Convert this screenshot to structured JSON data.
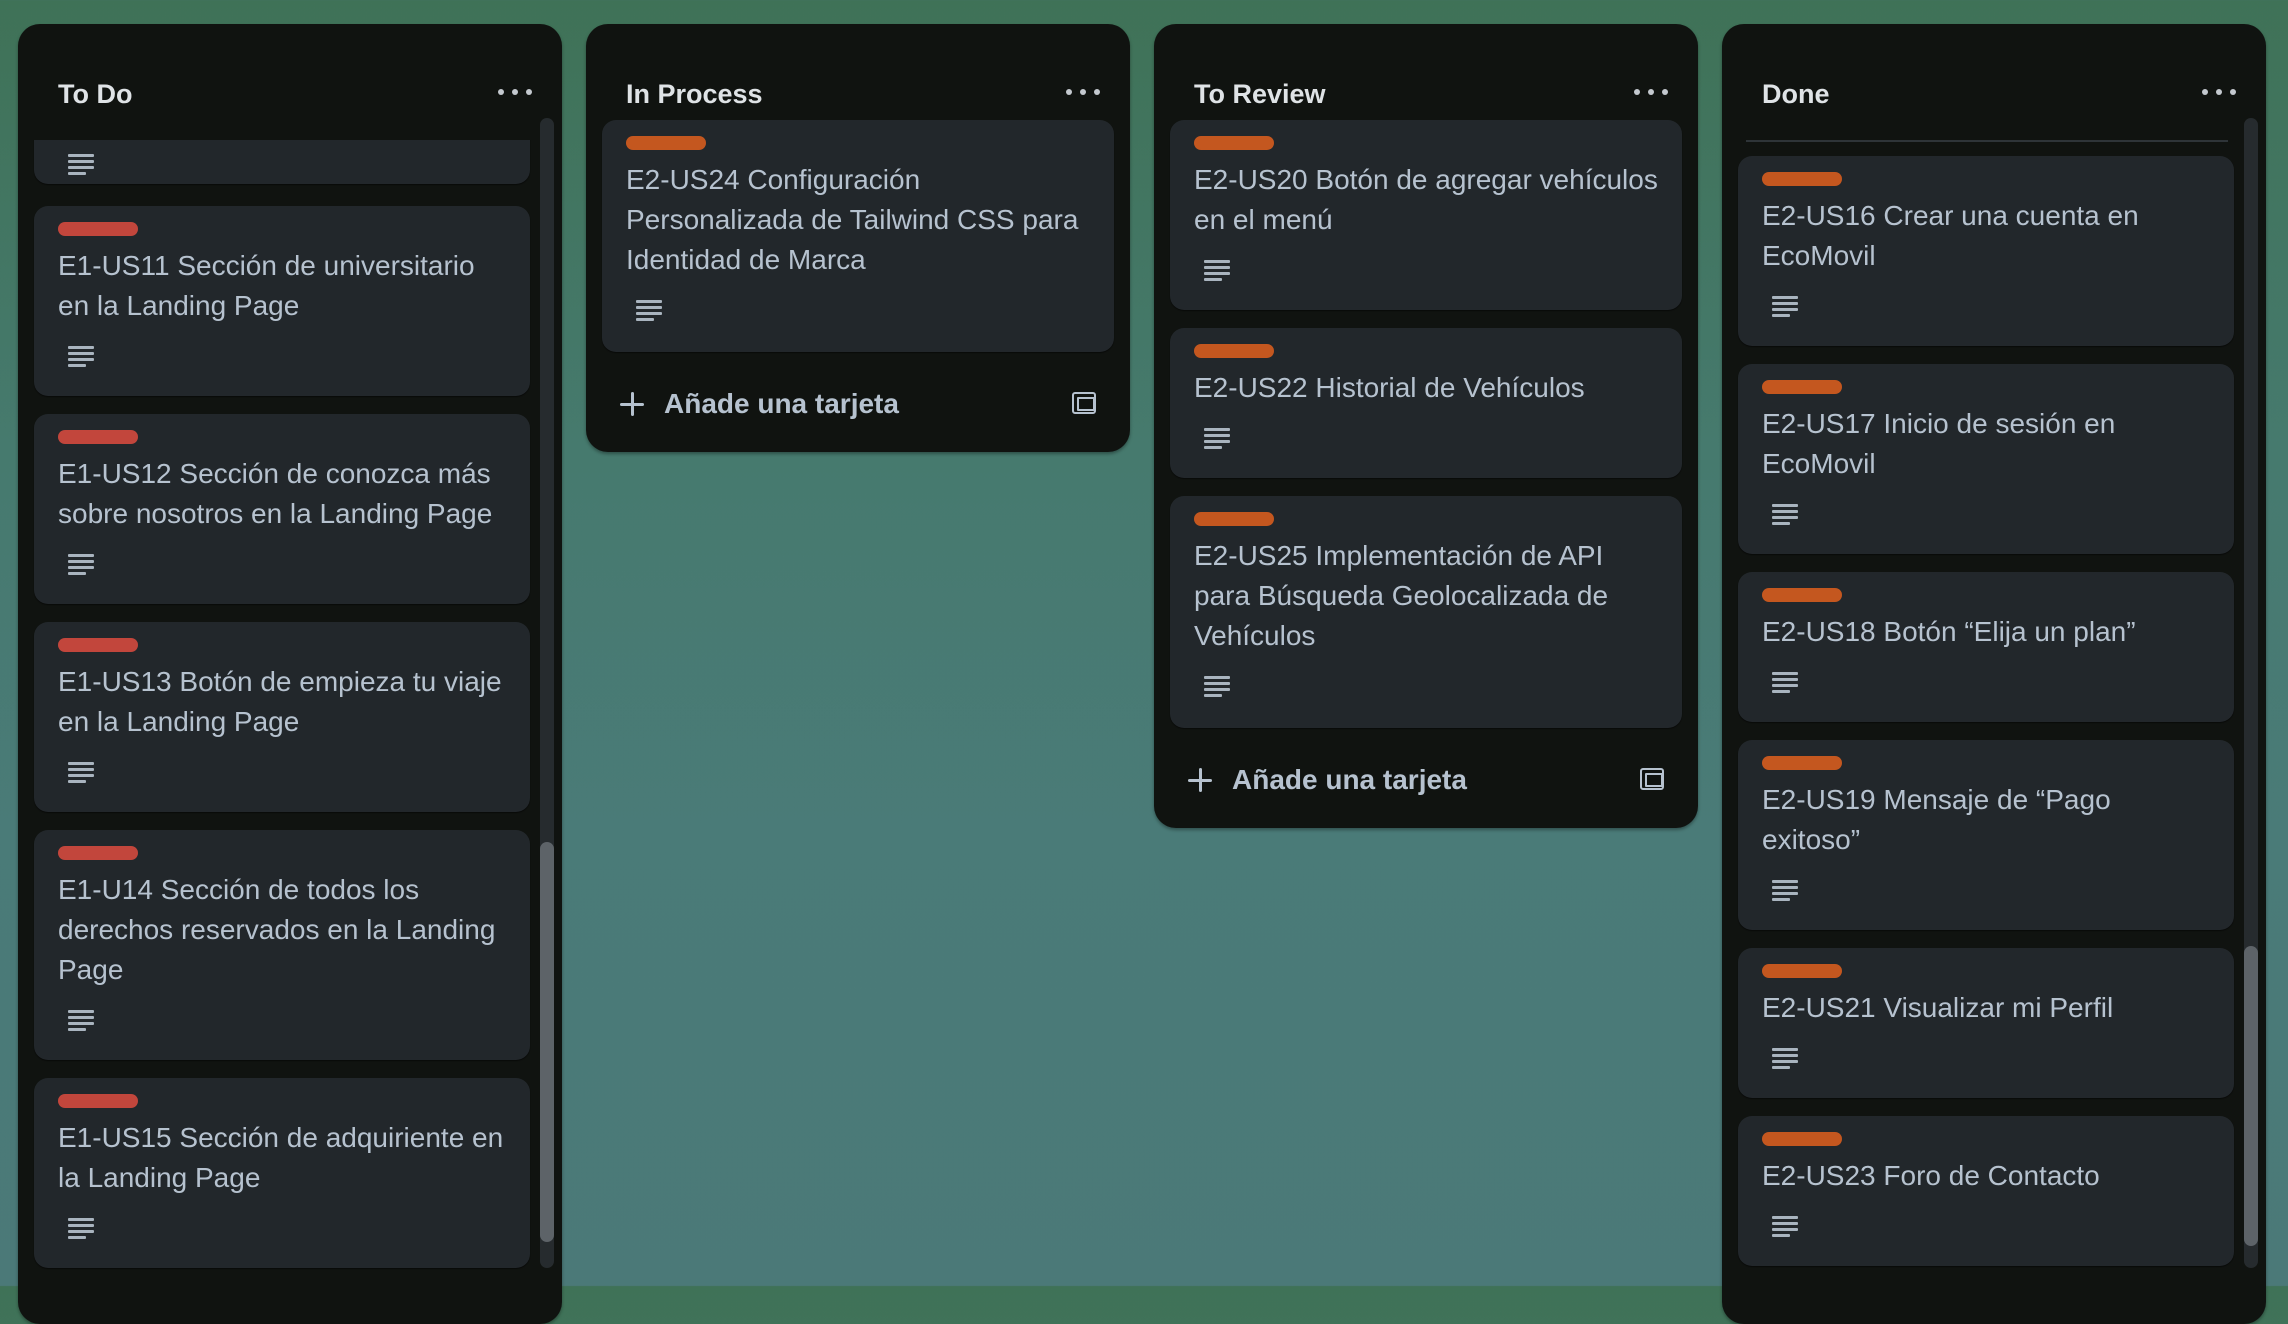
{
  "board": {
    "add_card_label": "Añade una tarjeta",
    "colors": {
      "list_bg": "#101310",
      "card_bg": "#22272b",
      "red_label": "#c2463c",
      "orange_label": "#c4571f",
      "text": "#b6c2cf"
    },
    "lists": [
      {
        "title": "To Do",
        "cards": [
          {
            "label": "red",
            "title": "",
            "has_description": true
          },
          {
            "label": "red",
            "title": "E1-US11 Sección de universitario en la Landing Page",
            "has_description": true
          },
          {
            "label": "red",
            "title": "E1-US12 Sección de conozca más sobre nosotros en la Landing Page",
            "has_description": true
          },
          {
            "label": "red",
            "title": "E1-US13 Botón de empieza tu viaje en la Landing Page",
            "has_description": true
          },
          {
            "label": "red",
            "title": "E1-U14 Sección de todos los derechos reservados en la Landing Page",
            "has_description": true
          },
          {
            "label": "red",
            "title": "E1-US15 Sección de adquiriente en la Landing Page",
            "has_description": true
          }
        ]
      },
      {
        "title": "In Process",
        "cards": [
          {
            "label": "orange",
            "title": "E2-US24 Configuración Personalizada de Tailwind CSS para Identidad de Marca",
            "has_description": true
          }
        ]
      },
      {
        "title": "To Review",
        "cards": [
          {
            "label": "orange",
            "title": "E2-US20 Botón de agregar vehículos en el menú",
            "has_description": true
          },
          {
            "label": "orange",
            "title": "E2-US22 Historial de Vehículos",
            "has_description": true
          },
          {
            "label": "orange",
            "title": "E2-US25 Implementación de API para Búsqueda Geolocalizada de Vehículos",
            "has_description": true
          }
        ]
      },
      {
        "title": "Done",
        "cards": [
          {
            "label": "orange",
            "title": "E2-US16 Crear una cuenta en EcoMovil",
            "has_description": true
          },
          {
            "label": "orange",
            "title": "E2-US17 Inicio de sesión en EcoMovil",
            "has_description": true
          },
          {
            "label": "orange",
            "title": "E2-US18 Botón “Elija un plan”",
            "has_description": true
          },
          {
            "label": "orange",
            "title": "E2-US19 Mensaje de “Pago exitoso”",
            "has_description": true
          },
          {
            "label": "orange",
            "title": "E2-US21 Visualizar mi Perfil",
            "has_description": true
          },
          {
            "label": "orange",
            "title": "E2-US23 Foro de Contacto",
            "has_description": true
          }
        ]
      }
    ]
  }
}
